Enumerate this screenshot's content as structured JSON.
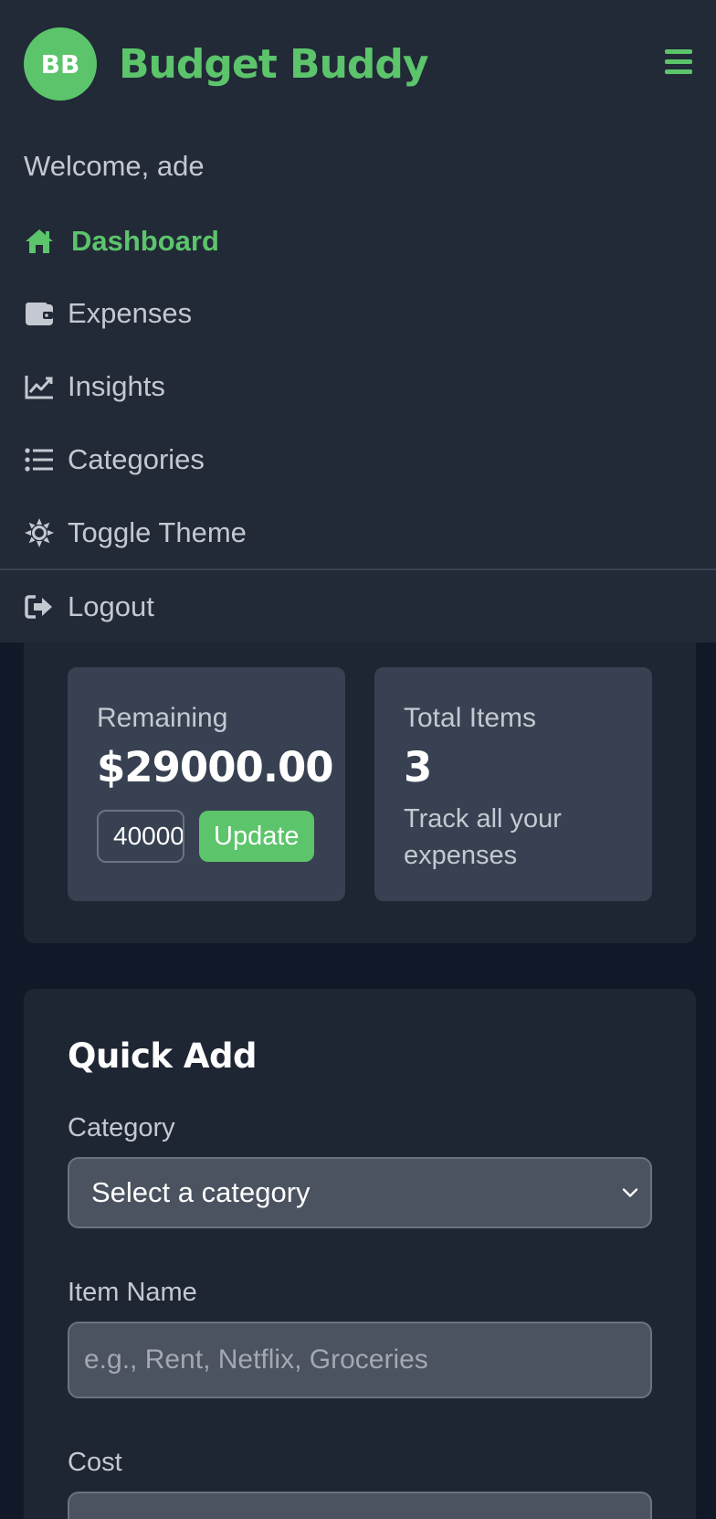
{
  "app": {
    "avatar_initials": "BB",
    "brand": "Budget Buddy",
    "accent_color": "#5cc46b"
  },
  "nav": {
    "welcome": "Welcome, ade",
    "items": [
      {
        "label": "Dashboard",
        "icon": "home-icon",
        "active": true
      },
      {
        "label": "Expenses",
        "icon": "wallet-icon",
        "active": false
      },
      {
        "label": "Insights",
        "icon": "chart-line-icon",
        "active": false
      },
      {
        "label": "Categories",
        "icon": "list-icon",
        "active": false
      },
      {
        "label": "Toggle Theme",
        "icon": "sun-icon",
        "active": false
      }
    ],
    "logout": {
      "label": "Logout",
      "icon": "logout-icon"
    },
    "menu_icon": "hamburger-icon"
  },
  "summary": {
    "remaining_label": "Remaining",
    "remaining_value": "$29000.00",
    "budget_input_value": "40000",
    "update_label": "Update",
    "total_label": "Total Items",
    "total_value": "3",
    "total_desc": "Track all your expenses"
  },
  "quick_add": {
    "title": "Quick Add",
    "category_label": "Category",
    "category_selected": "Select a category",
    "item_label": "Item Name",
    "item_placeholder": "e.g., Rent, Netflix, Groceries",
    "cost_label": "Cost"
  }
}
